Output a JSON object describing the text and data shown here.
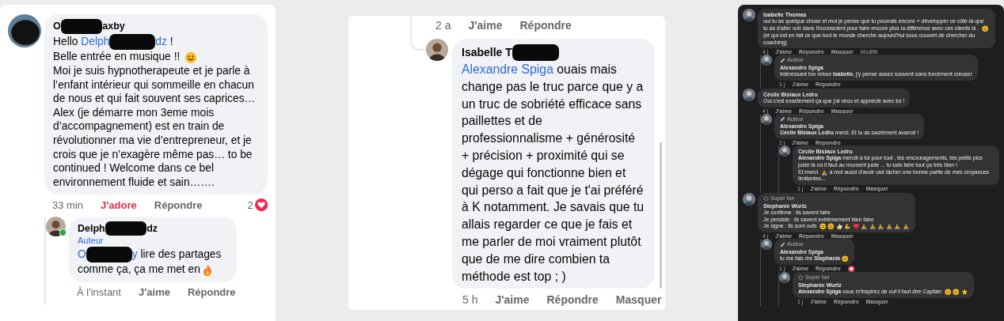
{
  "panels": [
    {
      "kind": "light",
      "comments": [
        {
          "avatar": {
            "kind": "redacted"
          },
          "name": [
            {
              "kind": "text",
              "text": "O"
            },
            {
              "kind": "redaction"
            },
            {
              "kind": "text",
              "text": "axby"
            }
          ],
          "body": [
            [
              {
                "kind": "text",
                "text": "Hello "
              },
              {
                "kind": "mention",
                "text": "Delph"
              },
              {
                "kind": "redaction"
              },
              {
                "kind": "mention",
                "text": "dz"
              },
              {
                "kind": "text",
                "text": " !"
              }
            ],
            [
              {
                "kind": "text",
                "text": "Belle entrée en musique !! "
              },
              {
                "kind": "smiley"
              }
            ],
            [
              {
                "kind": "text",
                "text": "Moi je suis hypnotherapeute et je parle à l’enfant intérieur qui sommeille en chacun de nous et qui fait souvent ses caprices…"
              }
            ],
            [
              {
                "kind": "text",
                "text": "Alex (je démarre mon 3eme mois d’accompagnement) est en train de révolutionner ma vie d’entrepreneur, et je crois que je n’exagère même pas… to be continued ! Welcome dans ce bel environnement fluide et sain……."
              }
            ]
          ],
          "footer": [
            {
              "kind": "time",
              "text": "33 min"
            },
            {
              "kind": "like",
              "text": "J'adore",
              "reacted": true
            },
            {
              "kind": "reply",
              "text": "Répondre"
            }
          ],
          "reaction": {
            "kind": "heart",
            "count": "2"
          },
          "children": [
            {
              "avatar": {
                "kind": "photo",
                "online": true
              },
              "name": [
                {
                  "kind": "text",
                  "text": "Delph"
                },
                {
                  "kind": "redaction"
                },
                {
                  "kind": "text",
                  "text": "dz"
                }
              ],
              "badge": {
                "kind": "author",
                "text": "Auteur"
              },
              "body": [
                [
                  {
                    "kind": "mention",
                    "text": "O"
                  },
                  {
                    "kind": "redaction"
                  },
                  {
                    "kind": "mention",
                    "text": "y"
                  },
                  {
                    "kind": "text",
                    "text": " lire des partages comme ça, ça me met en"
                  },
                  {
                    "kind": "fire"
                  }
                ]
              ],
              "footer": [
                {
                  "kind": "time",
                  "text": "À l'instant"
                },
                {
                  "kind": "like",
                  "text": "J'aime",
                  "reacted": false
                },
                {
                  "kind": "reply",
                  "text": "Répondre"
                }
              ]
            }
          ]
        }
      ]
    },
    {
      "kind": "card",
      "previous_footer": [
        {
          "kind": "time",
          "text": "2 a"
        },
        {
          "kind": "like",
          "text": "J'aime",
          "reacted": false
        },
        {
          "kind": "reply",
          "text": "Répondre"
        }
      ],
      "comments": [
        {
          "avatar": {
            "kind": "photo"
          },
          "name": [
            {
              "kind": "text",
              "text": "Isabelle T"
            },
            {
              "kind": "redaction"
            }
          ],
          "body": [
            [
              {
                "kind": "mention",
                "text": "Alexandre Spiga"
              },
              {
                "kind": "text",
                "text": " ouais mais change pas le truc parce que y a un truc de sobriété efficace sans paillettes et de professionnalisme + générosité + précision + proximité qui se dégage qui fonctionne bien et qui perso a fait que je t'ai préféré à K notamment. Je savais que tu allais regarder ce que je fais et me parler de moi vraiment plutôt que de me dire combien ta méthode est top ; )"
              }
            ]
          ],
          "footer": [
            {
              "kind": "time",
              "text": "5 h"
            },
            {
              "kind": "like",
              "text": "J'aime",
              "reacted": false
            },
            {
              "kind": "reply",
              "text": "Répondre"
            },
            {
              "kind": "hide",
              "text": "Masquer"
            }
          ]
        }
      ]
    },
    {
      "kind": "dark",
      "comments": [
        {
          "avatar": {
            "kind": "photo"
          },
          "name": [
            {
              "kind": "text",
              "text": "Isabelle Thomas"
            }
          ],
          "body": [
            [
              {
                "kind": "text",
                "text": "oui tu as quelque chose et moi je pense que tu pourrais encore + développer ce côté-là que tu as d'aller voir dans l'inconscient pour faire encore plus la différence avec ces clients là . "
              },
              {
                "kind": "smiley"
              },
              {
                "kind": "text",
                "text": " (et qui est en fait ce que tout le monde cherche aujourd'hui sous couvert de chercher du coaching)"
              }
            ]
          ],
          "footer": [
            {
              "kind": "time",
              "text": "4 j"
            },
            {
              "kind": "like",
              "text": "J'aime",
              "reacted": false
            },
            {
              "kind": "reply",
              "text": "Répondre"
            },
            {
              "kind": "hide",
              "text": "Masquer"
            },
            {
              "kind": "edited",
              "text": "Modifié"
            }
          ],
          "children": [
            {
              "avatar": {
                "kind": "photo"
              },
              "badge": {
                "kind": "author",
                "text": "Auteur"
              },
              "name": [
                {
                  "kind": "text",
                  "text": "Alexandre Spiga"
                }
              ],
              "body": [
                [
                  {
                    "kind": "text",
                    "text": "Intéressant ton retour "
                  },
                  {
                    "kind": "mention",
                    "text": "Isabelle"
                  },
                  {
                    "kind": "text",
                    "text": ", j'y pense assez souvent sans forcément creuser"
                  }
                ]
              ],
              "footer": [
                {
                  "kind": "time",
                  "text": "1 j"
                },
                {
                  "kind": "like",
                  "text": "J'aime",
                  "reacted": false
                },
                {
                  "kind": "reply",
                  "text": "Répondre"
                }
              ]
            }
          ]
        },
        {
          "avatar": {
            "kind": "photo"
          },
          "name": [
            {
              "kind": "text",
              "text": "Cécile Bisiaux Ledru"
            }
          ],
          "body": [
            [
              {
                "kind": "text",
                "text": "Oui c'est exactement ça que j'ai vécu et apprécié avec toi !"
              }
            ]
          ],
          "footer": [
            {
              "kind": "time",
              "text": "4 j"
            },
            {
              "kind": "like",
              "text": "J'aime",
              "reacted": false
            },
            {
              "kind": "reply",
              "text": "Répondre"
            },
            {
              "kind": "hide",
              "text": "Masquer"
            }
          ],
          "children": [
            {
              "avatar": {
                "kind": "photo"
              },
              "badge": {
                "kind": "author",
                "text": "Auteur"
              },
              "name": [
                {
                  "kind": "text",
                  "text": "Alexandre Spiga"
                }
              ],
              "body": [
                [
                  {
                    "kind": "mention",
                    "text": "Cécile Bisiaux Ledru"
                  },
                  {
                    "kind": "text",
                    "text": " merci. Et tu as sacrément avancé !"
                  }
                ]
              ],
              "footer": [
                {
                  "kind": "time",
                  "text": "1 j"
                },
                {
                  "kind": "like",
                  "text": "J'aime",
                  "reacted": false
                },
                {
                  "kind": "reply",
                  "text": "Répondre"
                }
              ],
              "children": [
                {
                  "avatar": {
                    "kind": "photo"
                  },
                  "name": [
                    {
                      "kind": "text",
                      "text": "Cécile Bisiaux Ledru"
                    }
                  ],
                  "body": [
                    [
                      {
                        "kind": "mention",
                        "text": "Alexandre Spiga"
                      },
                      {
                        "kind": "text",
                        "text": " merciii à toi pour tout , tes encouragements, tes petits pics juste là où il faut au moment juste ... tu sais faire tout ça très bien !"
                      }
                    ],
                    [
                      {
                        "kind": "text",
                        "text": "Et merci "
                      },
                      {
                        "kind": "pray"
                      },
                      {
                        "kind": "text",
                        "text": " à moi aussi d'avoir osé lâcher une bonne partie de mes croyances limitantes..."
                      }
                    ]
                  ],
                  "footer": [
                    {
                      "kind": "time",
                      "text": "1 j"
                    },
                    {
                      "kind": "like",
                      "text": "J'aime",
                      "reacted": false
                    },
                    {
                      "kind": "reply",
                      "text": "Répondre"
                    },
                    {
                      "kind": "hide",
                      "text": "Masquer"
                    }
                  ]
                }
              ]
            }
          ]
        },
        {
          "avatar": {
            "kind": "photo"
          },
          "badge": {
            "kind": "superfan",
            "text": "Super fan"
          },
          "name": [
            {
              "kind": "text",
              "text": "Stephanie Wurtz"
            }
          ],
          "body": [
            [
              {
                "kind": "text",
                "text": "Je confirme : ils savent faire"
              }
            ],
            [
              {
                "kind": "text",
                "text": "Je persiste : ils savent extrêmement bien faire"
              }
            ],
            [
              {
                "kind": "text",
                "text": "Je signe : ils sont oufs "
              },
              {
                "kind": "smiley"
              },
              {
                "kind": "smiley"
              },
              {
                "kind": "thumb"
              },
              {
                "kind": "muscle"
              },
              {
                "kind": "heart"
              },
              {
                "kind": "pray"
              },
              {
                "kind": "pray"
              },
              {
                "kind": "pray"
              },
              {
                "kind": "pray"
              },
              {
                "kind": "pray"
              },
              {
                "kind": "pray"
              }
            ]
          ],
          "footer": [
            {
              "kind": "time",
              "text": "4 j"
            },
            {
              "kind": "like",
              "text": "J'aime",
              "reacted": false
            },
            {
              "kind": "reply",
              "text": "Répondre"
            },
            {
              "kind": "hide",
              "text": "Masquer"
            }
          ],
          "children": [
            {
              "avatar": {
                "kind": "photo"
              },
              "badge": {
                "kind": "author",
                "text": "Auteur"
              },
              "name": [
                {
                  "kind": "text",
                  "text": "Alexandre Spiga"
                }
              ],
              "body": [
                [
                  {
                    "kind": "text",
                    "text": "tu me fais rire "
                  },
                  {
                    "kind": "mention",
                    "text": "Stephanie"
                  },
                  {
                    "kind": "smiley"
                  }
                ]
              ],
              "reaction": {
                "kind": "heart"
              },
              "footer": [
                {
                  "kind": "time",
                  "text": "1 j"
                },
                {
                  "kind": "like",
                  "text": "J'aime",
                  "reacted": false
                },
                {
                  "kind": "reply",
                  "text": "Répondre"
                }
              ],
              "children": [
                {
                  "avatar": {
                    "kind": "photo"
                  },
                  "badge": {
                    "kind": "superfan",
                    "text": "Super fan"
                  },
                  "name": [
                    {
                      "kind": "text",
                      "text": "Stephanie Wurtz"
                    }
                  ],
                  "body": [
                    [
                      {
                        "kind": "mention",
                        "text": "Alexandre Spiga"
                      },
                      {
                        "kind": "text",
                        "text": " vous m'inspirez de ouf il faut dire Captain "
                      },
                      {
                        "kind": "smiley"
                      },
                      {
                        "kind": "smiley"
                      },
                      {
                        "kind": "star"
                      }
                    ]
                  ],
                  "footer": [
                    {
                      "kind": "time",
                      "text": "1 j"
                    },
                    {
                      "kind": "like",
                      "text": "J'aime",
                      "reacted": false
                    },
                    {
                      "kind": "reply",
                      "text": "Répondre"
                    },
                    {
                      "kind": "hide",
                      "text": "Masquer"
                    }
                  ]
                }
              ]
            }
          ]
        }
      ]
    }
  ]
}
